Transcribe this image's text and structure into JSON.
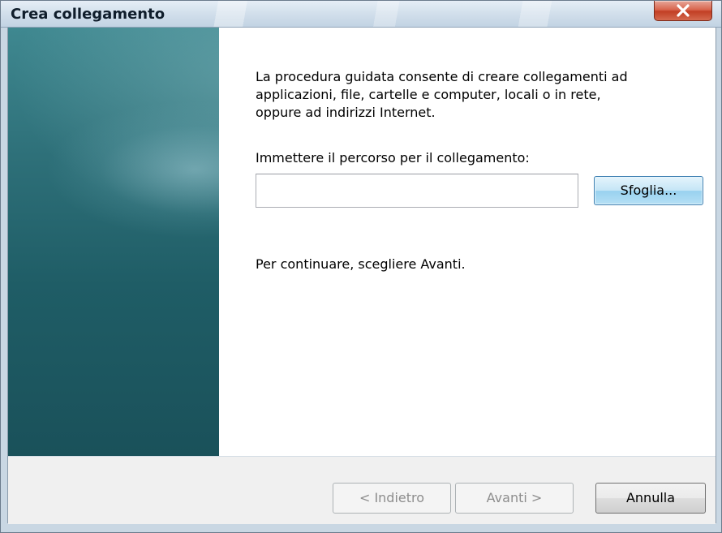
{
  "window": {
    "title": "Crea collegamento"
  },
  "content": {
    "intro_line1": "La procedura guidata consente di creare collegamenti ad",
    "intro_line2": "applicazioni, file, cartelle e computer, locali o in rete,",
    "intro_line3": "oppure ad indirizzi Internet.",
    "path_label": "Immettere il percorso per il collegamento:",
    "path_value": "",
    "browse_label": "Sfoglia...",
    "continue_text": "Per continuare, scegliere Avanti."
  },
  "footer": {
    "back_label": "< Indietro",
    "next_label": "Avanti >",
    "cancel_label": "Annulla"
  },
  "colors": {
    "side_panel": "#2e7079",
    "close_button": "#c23f24",
    "browse_button_border": "#3c7fb1"
  },
  "icons": {
    "close": "close-icon"
  }
}
